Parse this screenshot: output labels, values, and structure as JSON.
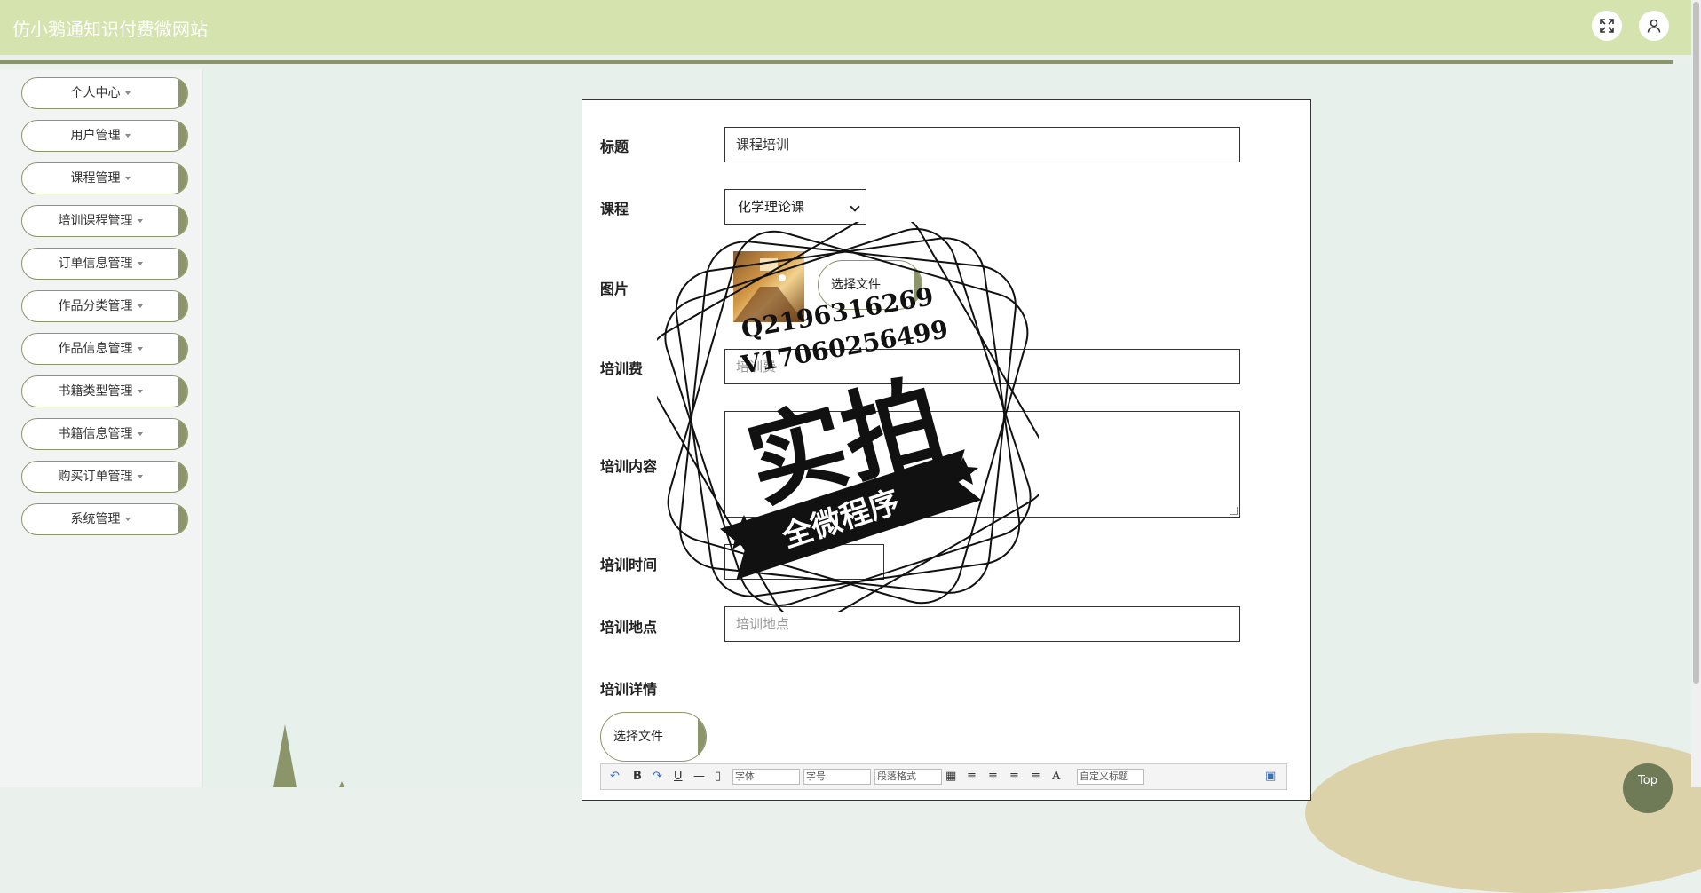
{
  "header": {
    "title": "仿小鹅通知识付费微网站"
  },
  "sidebar": {
    "items": [
      {
        "label": "个人中心"
      },
      {
        "label": "用户管理"
      },
      {
        "label": "课程管理"
      },
      {
        "label": "培训课程管理"
      },
      {
        "label": "订单信息管理"
      },
      {
        "label": "作品分类管理"
      },
      {
        "label": "作品信息管理"
      },
      {
        "label": "书籍类型管理"
      },
      {
        "label": "书籍信息管理"
      },
      {
        "label": "购买订单管理"
      },
      {
        "label": "系统管理"
      }
    ]
  },
  "form": {
    "title_label": "标题",
    "title_value": "课程培训",
    "course_label": "课程",
    "course_value": "化学理论课",
    "image_label": "图片",
    "choose_file": "选择文件",
    "fee_label": "培训费",
    "fee_placeholder": "培训费",
    "content_label": "培训内容",
    "time_label": "培训时间",
    "location_label": "培训地点",
    "location_placeholder": "培训地点",
    "details_label": "培训详情",
    "details_choose_file": "选择文件"
  },
  "editor_toolbar": {
    "font": "字体",
    "size": "字号",
    "paragraph": "段落格式",
    "custom_title": "自定义标题",
    "bold": "B",
    "underline": "U",
    "font_color": "A"
  },
  "watermark": {
    "line1": "Q2196316269",
    "line2": "V17060256499",
    "main": "实拍",
    "banner": "全微程序"
  },
  "top_button": {
    "label": "Top"
  },
  "colors": {
    "header_bg": "#d5e3ae",
    "accent": "#8b9569",
    "main_bg": "#e8f0ec"
  }
}
